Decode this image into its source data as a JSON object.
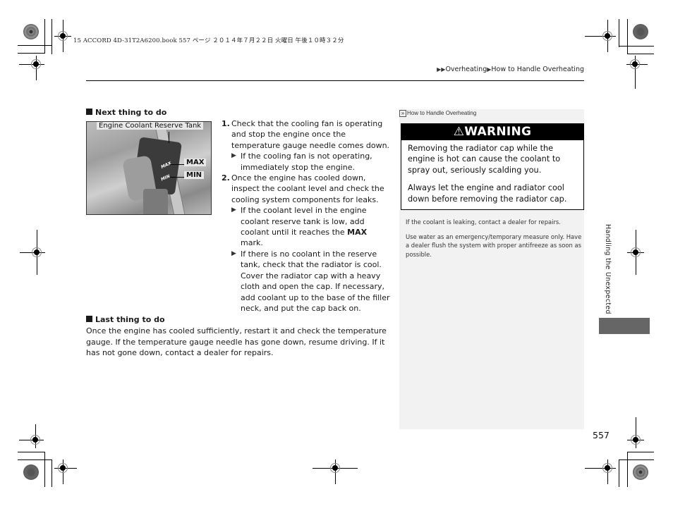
{
  "print_slug": "15 ACCORD 4D-31T2A6200.book  557 ページ  ２０１４年７月２２日  火曜日  午後１０時３２分",
  "breadcrumb": {
    "icon": "double-triangle-right",
    "items": [
      "Overheating",
      "How to Handle Overheating"
    ]
  },
  "sections": {
    "next": {
      "heading": "Next thing to do",
      "figure": {
        "callout_tank": "Engine Coolant Reserve Tank",
        "callout_max": "MAX",
        "callout_min": "MIN",
        "mark_max": "MAX",
        "mark_min": "MIN"
      },
      "steps": [
        {
          "number": "1.",
          "text": "Check that the cooling fan is operating and stop the engine once the temperature gauge needle comes down.",
          "subs": [
            {
              "text": "If the cooling fan is not operating, immediately stop the engine."
            }
          ]
        },
        {
          "number": "2.",
          "text": "Once the engine has cooled down, inspect the coolant level and check the cooling system components for leaks.",
          "subs": [
            {
              "pre": "If the coolant level in the engine coolant reserve tank is low, add coolant until it reaches the ",
              "bold": "MAX",
              "post": " mark."
            },
            {
              "text": "If there is no coolant in the reserve tank, check that the radiator is cool. Cover the radiator cap with a heavy cloth and open the cap. If necessary, add coolant up to the base of the filler neck, and put the cap back on."
            }
          ]
        }
      ]
    },
    "last": {
      "heading": "Last thing to do",
      "body": "Once the engine has cooled sufficiently, restart it and check the temperature gauge. If the temperature gauge needle has gone down, resume driving. If it has not gone down, contact a dealer for repairs."
    }
  },
  "sidebar": {
    "ref_label": "How to Handle Overheating",
    "warning": {
      "title": "WARNING",
      "icon": "warning-triangle",
      "paragraphs": [
        "Removing the radiator cap while the engine is hot can cause the coolant to spray out, seriously scalding you.",
        "Always let the engine and radiator cool down before removing the radiator cap."
      ]
    },
    "notes": [
      "If the coolant is leaking, contact a dealer for repairs.",
      "Use water as an emergency/temporary measure only. Have a dealer flush the system with proper antifreeze as soon as possible."
    ]
  },
  "chapter_tab": "Handling the Unexpected",
  "page_number": "557"
}
